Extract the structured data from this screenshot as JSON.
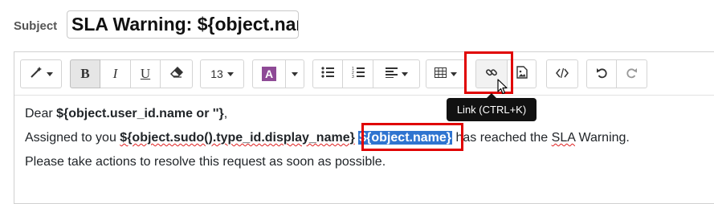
{
  "subject": {
    "label": "Subject",
    "value": "SLA Warning: ${object.name}"
  },
  "toolbar": {
    "style_icon": "magic-wand-icon",
    "bold": "B",
    "italic": "I",
    "underline": "U",
    "eraser_icon": "eraser-icon",
    "font_size": "13",
    "color": "A",
    "color_accent": "#8e4a96",
    "ul_icon": "bullet-list-icon",
    "ol_icon": "numbered-list-icon",
    "align_icon": "align-icon",
    "table_icon": "table-icon",
    "link_icon": "link-icon",
    "image_icon": "image-icon",
    "code_icon": "code-view-icon",
    "undo_icon": "undo-icon",
    "redo_icon": "redo-icon",
    "tooltip": "Link (CTRL+K)"
  },
  "body": {
    "line1": {
      "prefix": "Dear ",
      "bold": "${object.user_id.name or ''}",
      "suffix": ","
    },
    "line2": {
      "prefix": "Assigned to you ",
      "bold": "${object.sudo().type_id.display_name}",
      "space": " ",
      "selected": "${object.name}",
      "middle": " has reached the ",
      "sla": "SLA",
      "suffix": " Warning."
    },
    "line3": "Please take actions to resolve this request as soon as possible."
  },
  "colors": {
    "highlight": "#e00000",
    "selection": "#2f74d0"
  }
}
